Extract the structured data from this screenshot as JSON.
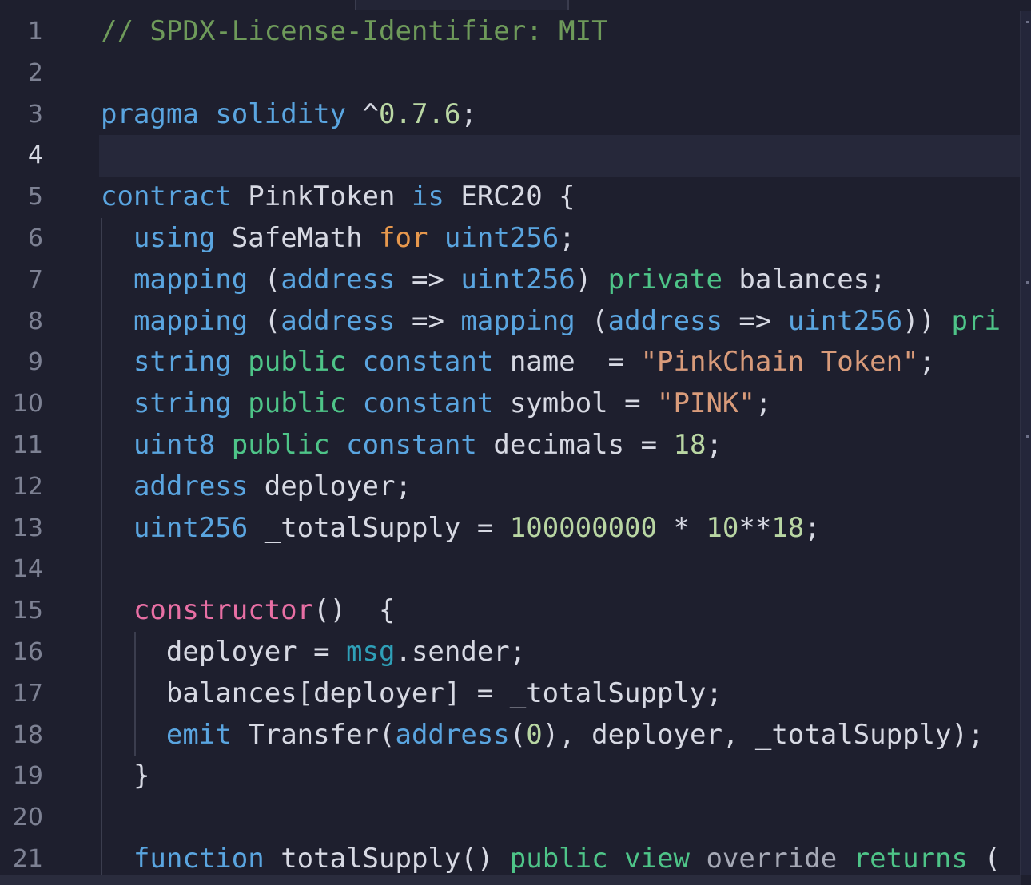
{
  "editor": {
    "active_line": 4,
    "line_numbers": [
      "1",
      "2",
      "3",
      "4",
      "5",
      "6",
      "7",
      "8",
      "9",
      "10",
      "11",
      "12",
      "13",
      "14",
      "15",
      "16",
      "17",
      "18",
      "19",
      "20",
      "21"
    ],
    "lines": [
      [
        {
          "t": "// SPDX-License-Identifier: MIT",
          "c": "comment"
        }
      ],
      [],
      [
        {
          "t": "pragma",
          "c": "keyword"
        },
        {
          "t": " ",
          "c": "plain"
        },
        {
          "t": "solidity",
          "c": "keyword"
        },
        {
          "t": " ^",
          "c": "plain"
        },
        {
          "t": "0.7.6",
          "c": "number"
        },
        {
          "t": ";",
          "c": "plain"
        }
      ],
      [],
      [
        {
          "t": "contract",
          "c": "keyword"
        },
        {
          "t": " PinkToken ",
          "c": "plain"
        },
        {
          "t": "is",
          "c": "keyword"
        },
        {
          "t": " ERC20 {",
          "c": "plain"
        }
      ],
      [
        {
          "t": "  ",
          "c": "plain"
        },
        {
          "t": "using",
          "c": "keyword"
        },
        {
          "t": " SafeMath ",
          "c": "plain"
        },
        {
          "t": "for",
          "c": "control"
        },
        {
          "t": " ",
          "c": "plain"
        },
        {
          "t": "uint256",
          "c": "type"
        },
        {
          "t": ";",
          "c": "plain"
        }
      ],
      [
        {
          "t": "  ",
          "c": "plain"
        },
        {
          "t": "mapping",
          "c": "type"
        },
        {
          "t": " (",
          "c": "plain"
        },
        {
          "t": "address",
          "c": "type"
        },
        {
          "t": " => ",
          "c": "plain"
        },
        {
          "t": "uint256",
          "c": "type"
        },
        {
          "t": ") ",
          "c": "plain"
        },
        {
          "t": "private",
          "c": "modifier"
        },
        {
          "t": " balances;",
          "c": "plain"
        }
      ],
      [
        {
          "t": "  ",
          "c": "plain"
        },
        {
          "t": "mapping",
          "c": "type"
        },
        {
          "t": " (",
          "c": "plain"
        },
        {
          "t": "address",
          "c": "type"
        },
        {
          "t": " => ",
          "c": "plain"
        },
        {
          "t": "mapping",
          "c": "type"
        },
        {
          "t": " (",
          "c": "plain"
        },
        {
          "t": "address",
          "c": "type"
        },
        {
          "t": " => ",
          "c": "plain"
        },
        {
          "t": "uint256",
          "c": "type"
        },
        {
          "t": ")) ",
          "c": "plain"
        },
        {
          "t": "pri",
          "c": "modifier"
        }
      ],
      [
        {
          "t": "  ",
          "c": "plain"
        },
        {
          "t": "string",
          "c": "type"
        },
        {
          "t": " ",
          "c": "plain"
        },
        {
          "t": "public",
          "c": "modifier"
        },
        {
          "t": " ",
          "c": "plain"
        },
        {
          "t": "constant",
          "c": "keyword"
        },
        {
          "t": " name  = ",
          "c": "plain"
        },
        {
          "t": "\"PinkChain Token\"",
          "c": "string"
        },
        {
          "t": ";",
          "c": "plain"
        }
      ],
      [
        {
          "t": "  ",
          "c": "plain"
        },
        {
          "t": "string",
          "c": "type"
        },
        {
          "t": " ",
          "c": "plain"
        },
        {
          "t": "public",
          "c": "modifier"
        },
        {
          "t": " ",
          "c": "plain"
        },
        {
          "t": "constant",
          "c": "keyword"
        },
        {
          "t": " symbol = ",
          "c": "plain"
        },
        {
          "t": "\"PINK\"",
          "c": "string"
        },
        {
          "t": ";",
          "c": "plain"
        }
      ],
      [
        {
          "t": "  ",
          "c": "plain"
        },
        {
          "t": "uint8",
          "c": "type"
        },
        {
          "t": " ",
          "c": "plain"
        },
        {
          "t": "public",
          "c": "modifier"
        },
        {
          "t": " ",
          "c": "plain"
        },
        {
          "t": "constant",
          "c": "keyword"
        },
        {
          "t": " decimals = ",
          "c": "plain"
        },
        {
          "t": "18",
          "c": "number"
        },
        {
          "t": ";",
          "c": "plain"
        }
      ],
      [
        {
          "t": "  ",
          "c": "plain"
        },
        {
          "t": "address",
          "c": "type"
        },
        {
          "t": " deployer;",
          "c": "plain"
        }
      ],
      [
        {
          "t": "  ",
          "c": "plain"
        },
        {
          "t": "uint256",
          "c": "type"
        },
        {
          "t": " _totalSupply = ",
          "c": "plain"
        },
        {
          "t": "100000000",
          "c": "number"
        },
        {
          "t": " * ",
          "c": "plain"
        },
        {
          "t": "10",
          "c": "number"
        },
        {
          "t": "**",
          "c": "plain"
        },
        {
          "t": "18",
          "c": "number"
        },
        {
          "t": ";",
          "c": "plain"
        }
      ],
      [],
      [
        {
          "t": "  ",
          "c": "plain"
        },
        {
          "t": "constructor",
          "c": "ctor"
        },
        {
          "t": "()  {",
          "c": "plain"
        }
      ],
      [
        {
          "t": "    deployer = ",
          "c": "plain"
        },
        {
          "t": "msg",
          "c": "global"
        },
        {
          "t": ".sender;",
          "c": "plain"
        }
      ],
      [
        {
          "t": "    balances[deployer] = _totalSupply;",
          "c": "plain"
        }
      ],
      [
        {
          "t": "    ",
          "c": "plain"
        },
        {
          "t": "emit",
          "c": "keyword"
        },
        {
          "t": " Transfer(",
          "c": "plain"
        },
        {
          "t": "address",
          "c": "type"
        },
        {
          "t": "(",
          "c": "plain"
        },
        {
          "t": "0",
          "c": "number"
        },
        {
          "t": "), deployer, _totalSupply);",
          "c": "plain"
        }
      ],
      [
        {
          "t": "  }",
          "c": "plain"
        }
      ],
      [],
      [
        {
          "t": "  ",
          "c": "plain"
        },
        {
          "t": "function",
          "c": "keyword"
        },
        {
          "t": " totalSupply() ",
          "c": "plain"
        },
        {
          "t": "public",
          "c": "modifier"
        },
        {
          "t": " ",
          "c": "plain"
        },
        {
          "t": "view",
          "c": "modifier"
        },
        {
          "t": " ",
          "c": "plain"
        },
        {
          "t": "override",
          "c": "dim"
        },
        {
          "t": " ",
          "c": "plain"
        },
        {
          "t": "returns",
          "c": "modifier"
        },
        {
          "t": " (",
          "c": "plain"
        }
      ]
    ]
  }
}
